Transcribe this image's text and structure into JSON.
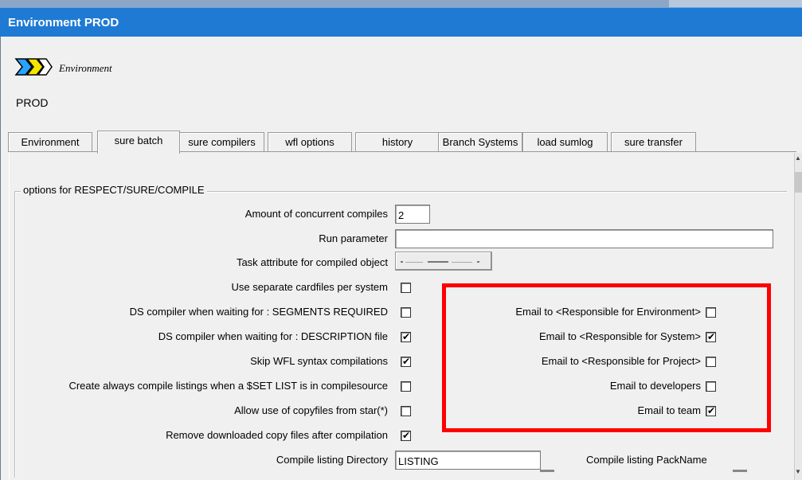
{
  "window": {
    "title": "Environment PROD"
  },
  "header": {
    "icon": "environment-chevron-icon",
    "type_label": "Environment",
    "name": "PROD"
  },
  "tabs": [
    {
      "label": "Environment"
    },
    {
      "label": "sure batch",
      "active": true
    },
    {
      "label": "sure compilers"
    },
    {
      "label": "wfl options"
    },
    {
      "label": "history"
    },
    {
      "label": "Branch Systems"
    },
    {
      "label": "load sumlog"
    },
    {
      "label": "sure transfer"
    }
  ],
  "group": {
    "title": "options for RESPECT/SURE/COMPILE"
  },
  "fields": {
    "concurrent_compiles": {
      "label": "Amount of concurrent compiles",
      "value": "2"
    },
    "run_parameter": {
      "label": "Run parameter",
      "value": ""
    },
    "task_attribute": {
      "label": "Task attribute for compiled object"
    },
    "separate_cardfiles": {
      "label": "Use separate cardfiles per system",
      "checked": false
    },
    "ds_segments": {
      "label": "DS compiler when waiting for : SEGMENTS REQUIRED",
      "checked": false
    },
    "ds_description": {
      "label": "DS compiler when waiting for : DESCRIPTION file",
      "checked": true
    },
    "skip_wfl": {
      "label": "Skip WFL syntax compilations",
      "checked": true
    },
    "compile_listings": {
      "label": "Create always compile listings when a $SET LIST is in compilesource",
      "checked": false
    },
    "copyfiles_star": {
      "label": "Allow use of copyfiles from star(*)",
      "checked": false
    },
    "remove_copy": {
      "label": "Remove downloaded copy files after compilation",
      "checked": true
    },
    "listing_dir": {
      "label": "Compile listing Directory",
      "value": "LISTING"
    },
    "listing_pack": {
      "label": "Compile listing PackName"
    }
  },
  "email": {
    "environment": {
      "label": "Email to <Responsible for Environment>",
      "checked": false
    },
    "system": {
      "label": "Email to <Responsible for System>",
      "checked": true
    },
    "project": {
      "label": "Email to <Responsible for Project>",
      "checked": false
    },
    "developers": {
      "label": "Email to developers",
      "checked": false
    },
    "team": {
      "label": "Email to team",
      "checked": true
    }
  },
  "colors": {
    "titlebar": "#1f7ad3",
    "highlight_box": "#ff0000",
    "background": "#f0f0f0"
  }
}
